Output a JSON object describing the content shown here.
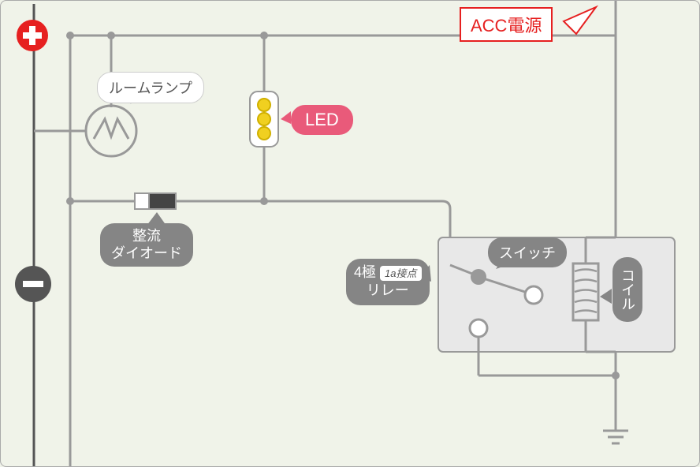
{
  "labels": {
    "acc_power": "ACC電源",
    "room_lamp": "ルームランプ",
    "led": "LED",
    "diode_line1": "整流",
    "diode_line2": "ダイオード",
    "relay_line1": "4極",
    "relay_line2": "リレー",
    "relay_contact": "1a接点",
    "switch": "スイッチ",
    "coil": "コイル"
  },
  "terminals": {
    "positive": "+",
    "negative": "−"
  },
  "colors": {
    "wire": "#999",
    "led_fill": "#f0d020",
    "led_border": "#d0b000",
    "accent": "#e62020",
    "label_gray": "#858585",
    "label_pink": "#e95a7a"
  }
}
